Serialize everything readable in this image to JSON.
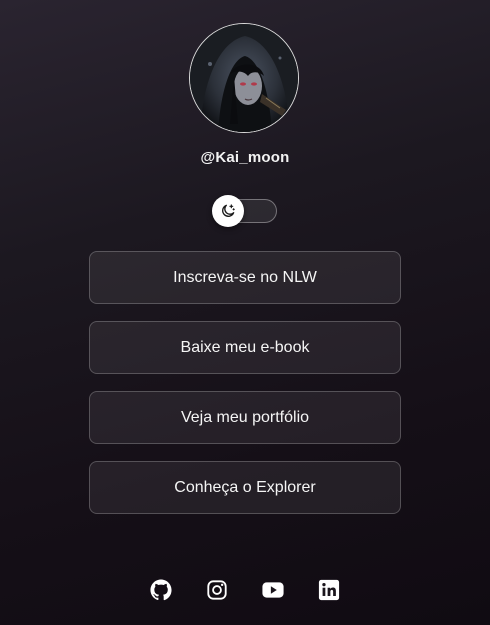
{
  "profile": {
    "username": "@Kai_moon",
    "avatar_icon": "profile-photo"
  },
  "theme_switch": {
    "icon": "moon-stars-icon",
    "mode": "dark"
  },
  "links": [
    {
      "label": "Inscreva-se no NLW"
    },
    {
      "label": "Baixe meu e-book"
    },
    {
      "label": "Veja meu portfólio"
    },
    {
      "label": "Conheça o Explorer"
    }
  ],
  "social": [
    {
      "icon": "github-icon"
    },
    {
      "icon": "instagram-icon"
    },
    {
      "icon": "youtube-icon"
    },
    {
      "icon": "linkedin-icon"
    }
  ],
  "colors": {
    "background": "#1c1820",
    "surface": "rgba(255,255,255,0.07)",
    "text": "#f5f5f5"
  }
}
